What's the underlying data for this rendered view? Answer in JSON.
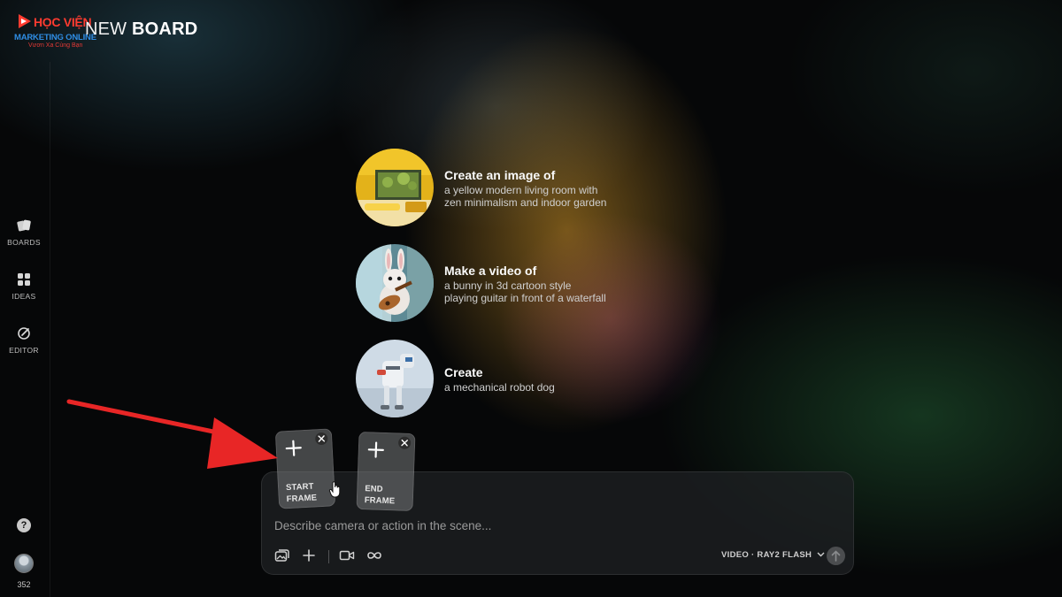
{
  "brand": {
    "logo_title": "HỌC VIỆN",
    "logo_subtitle": "MARKETING ONLINE",
    "logo_tagline": "Vươn Xa Cùng Bạn"
  },
  "board": {
    "title_part1": "NEW",
    "title_part2": "BOARD"
  },
  "sidebar": {
    "items": [
      {
        "label": "BOARDS",
        "icon": "boards-icon"
      },
      {
        "label": "IDEAS",
        "icon": "ideas-grid-icon"
      },
      {
        "label": "EDITOR",
        "icon": "editor-icon"
      }
    ],
    "help_label": "?",
    "credits": "352"
  },
  "suggestions": [
    {
      "title": "Create an image of",
      "lines": [
        "a yellow modern living room with",
        "zen minimalism and indoor garden"
      ],
      "thumb": "yellow-living-room"
    },
    {
      "title": "Make a video of",
      "lines": [
        "a bunny in 3d cartoon style",
        "playing guitar in front of a waterfall"
      ],
      "thumb": "bunny-guitar"
    },
    {
      "title": "Create",
      "lines": [
        "a mechanical robot dog"
      ],
      "thumb": "robot-dog"
    }
  ],
  "frames": {
    "start_line1": "START",
    "start_line2": "FRAME",
    "end_line1": "END",
    "end_line2": "FRAME"
  },
  "prompt": {
    "placeholder": "Describe camera or action in the scene...",
    "value": "",
    "model_label": "VIDEO · RAY2 FLASH"
  },
  "toolbar": {
    "icons": [
      "image-reference-icon",
      "sparkle-icon",
      "video-camera-icon",
      "loop-icon"
    ]
  },
  "colors": {
    "annotation_arrow": "#e82626",
    "logo_red": "#ff3b30",
    "logo_blue": "#2f8de4"
  }
}
